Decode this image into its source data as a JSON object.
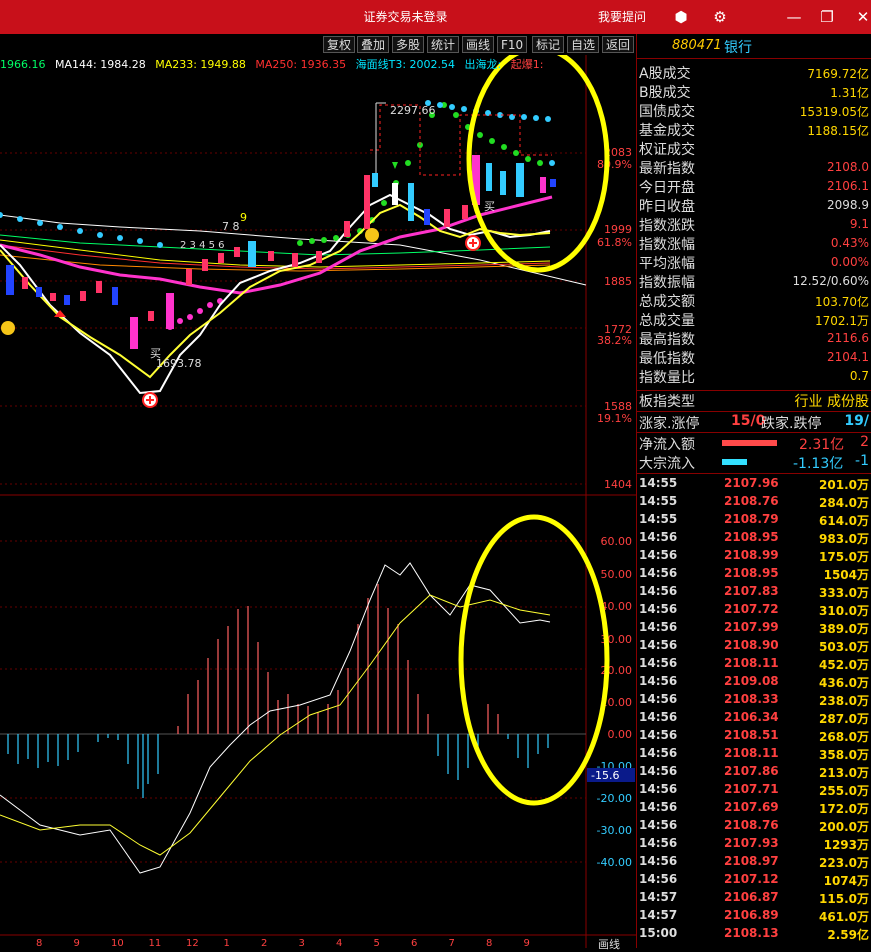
{
  "window": {
    "title": "证券交易未登录",
    "help": "我要提问"
  },
  "toolbar": [
    "复权",
    "叠加",
    "多股",
    "统计",
    "画线",
    "F10",
    "标记",
    "自选",
    "返回"
  ],
  "ma_legend": [
    {
      "text": "1966.16",
      "color": "#00ff66"
    },
    {
      "text": "MA144: 1984.28",
      "color": "#ffffff"
    },
    {
      "text": "MA233: 1949.88",
      "color": "#ffff00"
    },
    {
      "text": "MA250: 1936.35",
      "color": "#ff3030"
    },
    {
      "text": "海面线T3: 2002.54",
      "color": "#00e5ff"
    },
    {
      "text": "出海龙:",
      "color": "#00e5ff"
    },
    {
      "text": "起爆1:",
      "color": "#ff4040"
    }
  ],
  "price_axis": [
    "2083",
    "1999",
    "1885",
    "1772",
    "1588",
    "1404"
  ],
  "pct_axis": [
    "80.9%",
    "61.8%",
    "38.2%",
    "19.1%"
  ],
  "macd_axis": [
    "60.00",
    "50.00",
    "40.00",
    "30.00",
    "20.00",
    "10.00",
    "0.00",
    "-10.00",
    "-20.00",
    "-30.00",
    "-40.00"
  ],
  "macd_current": "-15.6",
  "annotations": {
    "high": "2297.66",
    "low": "1693.78",
    "buy1": "买",
    "buy2": "买",
    "nums": "7 8",
    "nine": "9",
    "seq": "2 3 4 5 6"
  },
  "date_axis": [
    "8",
    "9",
    "10",
    "11",
    "12",
    "1",
    "2",
    "3",
    "4",
    "5",
    "6",
    "7",
    "8",
    "9"
  ],
  "bottom_tab": "画线",
  "sidebar": {
    "code": "880471",
    "name": "银行",
    "stats": [
      {
        "k": "A股成交",
        "v": "7169.72亿",
        "c": "y"
      },
      {
        "k": "B股成交",
        "v": "1.31亿",
        "c": "y"
      },
      {
        "k": "国债成交",
        "v": "15319.05亿",
        "c": "y"
      },
      {
        "k": "基金成交",
        "v": "1188.15亿",
        "c": "y"
      },
      {
        "k": "权证成交",
        "v": "",
        "c": "y"
      },
      {
        "k": "最新指数",
        "v": "2108.0",
        "c": "r"
      },
      {
        "k": "今日开盘",
        "v": "2106.1",
        "c": "r"
      },
      {
        "k": "昨日收盘",
        "v": "2098.9",
        "c": "w"
      },
      {
        "k": "指数涨跌",
        "v": "9.1",
        "c": "r"
      },
      {
        "k": "指数涨幅",
        "v": "0.43%",
        "c": "r"
      },
      {
        "k": "平均涨幅",
        "v": "0.00%",
        "c": "r"
      },
      {
        "k": "指数振幅",
        "v": "12.52/0.60%",
        "c": "w"
      },
      {
        "k": "总成交额",
        "v": "103.70亿",
        "c": "y"
      },
      {
        "k": "总成交量",
        "v": "1702.1万",
        "c": "y"
      },
      {
        "k": "最高指数",
        "v": "2116.6",
        "c": "r"
      },
      {
        "k": "最低指数",
        "v": "2104.1",
        "c": "r"
      },
      {
        "k": "指数量比",
        "v": "0.7",
        "c": "y"
      }
    ],
    "type_label": "板指类型",
    "type_value": "行业 成份股",
    "updown_label": "涨家.涨停",
    "updown_value": "15/0",
    "down_label": "跌家.跌停",
    "down_value": "19/",
    "flow_in_label": "净流入额",
    "flow_in_value": "2.31亿",
    "flow_in_extra": "2",
    "block_label": "大宗流入",
    "block_value": "-1.13亿",
    "block_extra": "-1",
    "ticks": [
      [
        "14:55",
        "2107.96",
        "201.0万"
      ],
      [
        "14:55",
        "2108.76",
        "284.0万"
      ],
      [
        "14:55",
        "2108.79",
        "614.0万"
      ],
      [
        "14:56",
        "2108.95",
        "983.0万"
      ],
      [
        "14:56",
        "2108.99",
        "175.0万"
      ],
      [
        "14:56",
        "2108.95",
        "1504万"
      ],
      [
        "14:56",
        "2107.83",
        "333.0万"
      ],
      [
        "14:56",
        "2107.72",
        "310.0万"
      ],
      [
        "14:56",
        "2107.99",
        "389.0万"
      ],
      [
        "14:56",
        "2108.90",
        "503.0万"
      ],
      [
        "14:56",
        "2108.11",
        "452.0万"
      ],
      [
        "14:56",
        "2109.08",
        "436.0万"
      ],
      [
        "14:56",
        "2108.33",
        "238.0万"
      ],
      [
        "14:56",
        "2106.34",
        "287.0万"
      ],
      [
        "14:56",
        "2108.51",
        "268.0万"
      ],
      [
        "14:56",
        "2108.11",
        "358.0万"
      ],
      [
        "14:56",
        "2107.86",
        "213.0万"
      ],
      [
        "14:56",
        "2107.71",
        "255.0万"
      ],
      [
        "14:56",
        "2107.69",
        "172.0万"
      ],
      [
        "14:56",
        "2108.76",
        "200.0万"
      ],
      [
        "14:56",
        "2107.93",
        "1293万"
      ],
      [
        "14:56",
        "2108.97",
        "223.0万"
      ],
      [
        "14:56",
        "2107.12",
        "1074万"
      ],
      [
        "14:57",
        "2106.87",
        "115.0万"
      ],
      [
        "14:57",
        "2106.89",
        "461.0万"
      ],
      [
        "15:00",
        "2108.13",
        "2.59亿"
      ]
    ]
  }
}
